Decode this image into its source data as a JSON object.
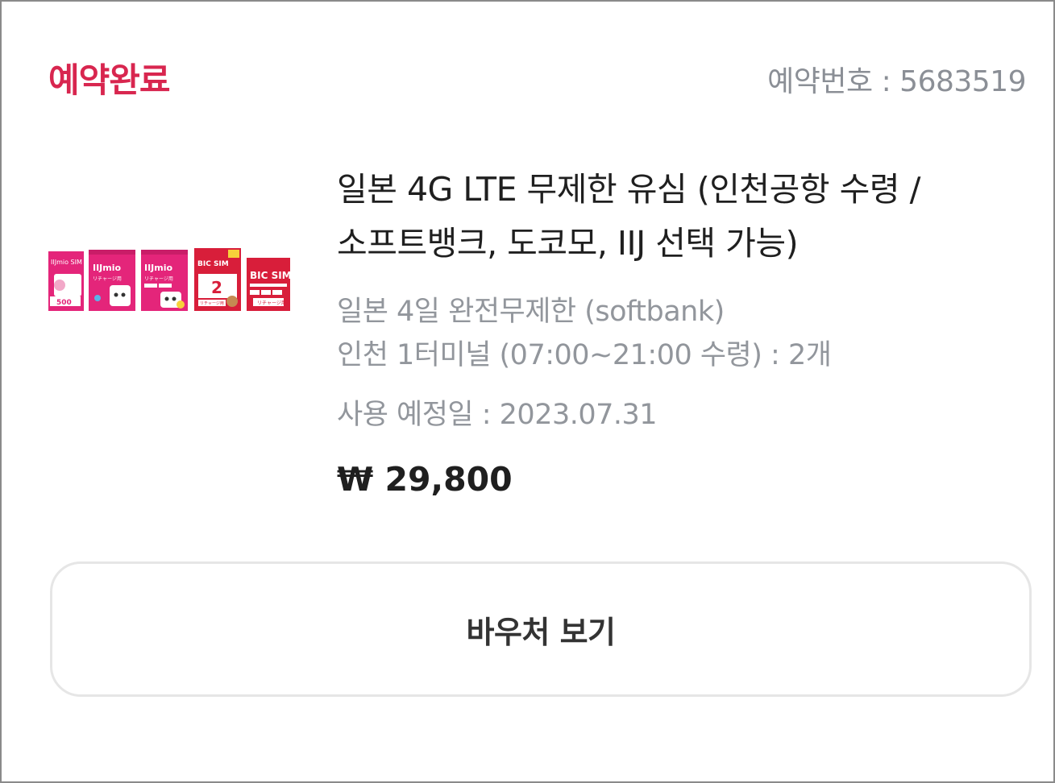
{
  "header": {
    "status_label": "예약완료",
    "reservation_label": "예약번호 : 5683519",
    "status_color": "#d8264f"
  },
  "product": {
    "thumbnail_texts": [
      "IIJmio SIM",
      "500",
      "IIJmio",
      "リチャージ用",
      "IIJmio",
      "リチャージ用",
      "BIC SIM",
      "2",
      "リチャージ用",
      "BIC SIM",
      "リチャージ用"
    ],
    "title_line1": "일본 4G LTE 무제한 유심 (인천공항 수령 /",
    "title_line2": "소프트뱅크, 도코모, IIJ 선택 가능)",
    "option_line1": "일본 4일 완전무제한 (softbank)",
    "option_line2": "인천 1터미널 (07:00~21:00 수령) : 2개",
    "use_date": "사용 예정일 : 2023.07.31",
    "price": "₩ 29,800"
  },
  "actions": {
    "voucher_label": "바우처 보기"
  }
}
